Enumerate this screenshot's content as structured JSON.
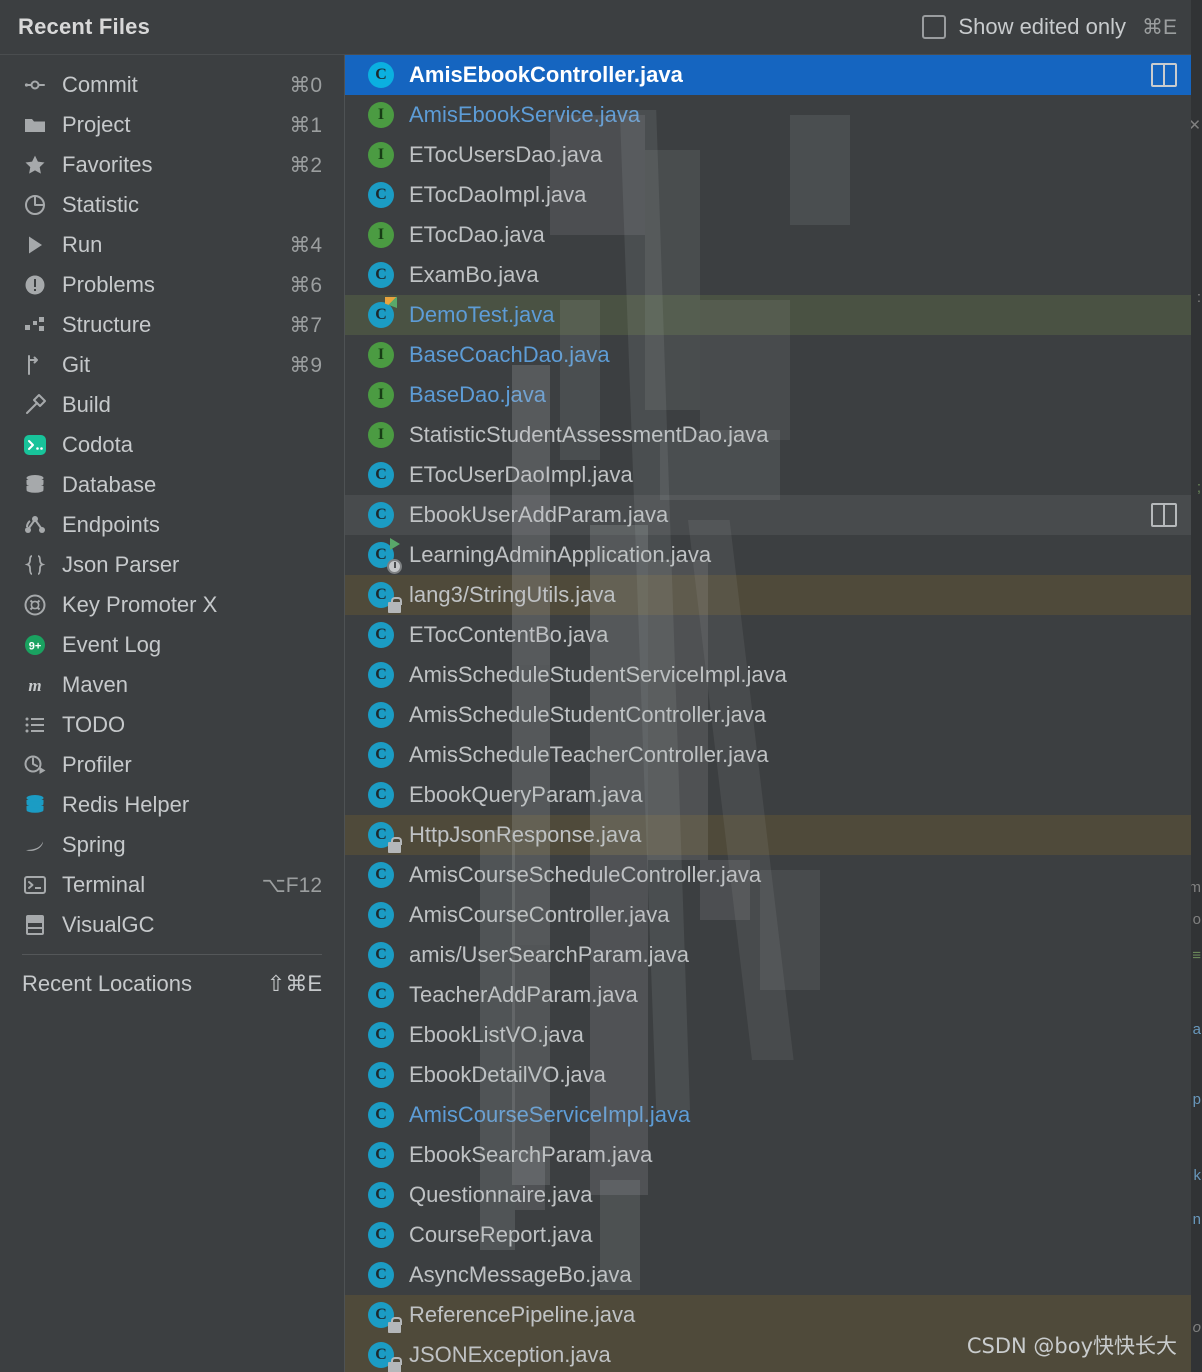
{
  "header": {
    "title": "Recent Files",
    "edited_only_label": "Show edited only",
    "edited_only_shortcut": "⌘E",
    "edited_only_checked": false
  },
  "sidebar": {
    "items": [
      {
        "label": "Commit",
        "shortcut": "⌘0",
        "icon": "commit-icon"
      },
      {
        "label": "Project",
        "shortcut": "⌘1",
        "icon": "folder-icon"
      },
      {
        "label": "Favorites",
        "shortcut": "⌘2",
        "icon": "star-icon"
      },
      {
        "label": "Statistic",
        "shortcut": "",
        "icon": "pie-chart-icon"
      },
      {
        "label": "Run",
        "shortcut": "⌘4",
        "icon": "play-icon"
      },
      {
        "label": "Problems",
        "shortcut": "⌘6",
        "icon": "exclamation-circle-icon"
      },
      {
        "label": "Structure",
        "shortcut": "⌘7",
        "icon": "structure-icon"
      },
      {
        "label": "Git",
        "shortcut": "⌘9",
        "icon": "git-branch-icon"
      },
      {
        "label": "Build",
        "shortcut": "",
        "icon": "hammer-icon"
      },
      {
        "label": "Codota",
        "shortcut": "",
        "icon": "codota-icon"
      },
      {
        "label": "Database",
        "shortcut": "",
        "icon": "database-icon"
      },
      {
        "label": "Endpoints",
        "shortcut": "",
        "icon": "endpoints-icon"
      },
      {
        "label": "Json Parser",
        "shortcut": "",
        "icon": "braces-icon"
      },
      {
        "label": "Key Promoter X",
        "shortcut": "",
        "icon": "key-promoter-icon"
      },
      {
        "label": "Event Log",
        "shortcut": "",
        "icon": "event-log-badge-icon"
      },
      {
        "label": "Maven",
        "shortcut": "",
        "icon": "maven-icon"
      },
      {
        "label": "TODO",
        "shortcut": "",
        "icon": "todo-list-icon"
      },
      {
        "label": "Profiler",
        "shortcut": "",
        "icon": "profiler-icon"
      },
      {
        "label": "Redis Helper",
        "shortcut": "",
        "icon": "redis-database-icon"
      },
      {
        "label": "Spring",
        "shortcut": "",
        "icon": "spring-leaf-icon"
      },
      {
        "label": "Terminal",
        "shortcut": "⌥F12",
        "icon": "terminal-icon"
      },
      {
        "label": "VisualGC",
        "shortcut": "",
        "icon": "visualgc-icon"
      }
    ],
    "recent_locations": {
      "label": "Recent Locations",
      "shortcut": "⇧⌘E"
    },
    "event_log_badge": "9+",
    "maven_glyph": "m"
  },
  "files": [
    {
      "name": "AmisEbookController.java",
      "kind": "class",
      "state": "selected",
      "split": true,
      "link": false,
      "badge": ""
    },
    {
      "name": "AmisEbookService.java",
      "kind": "interface",
      "state": "normal",
      "split": false,
      "link": true,
      "badge": ""
    },
    {
      "name": "ETocUsersDao.java",
      "kind": "interface",
      "state": "normal",
      "split": false,
      "link": false,
      "badge": ""
    },
    {
      "name": "ETocDaoImpl.java",
      "kind": "class",
      "state": "normal",
      "split": false,
      "link": false,
      "badge": ""
    },
    {
      "name": "ETocDao.java",
      "kind": "interface",
      "state": "normal",
      "split": false,
      "link": false,
      "badge": ""
    },
    {
      "name": "ExamBo.java",
      "kind": "class",
      "state": "normal",
      "split": false,
      "link": false,
      "badge": ""
    },
    {
      "name": "DemoTest.java",
      "kind": "class",
      "state": "green",
      "split": false,
      "link": true,
      "badge": "flag"
    },
    {
      "name": "BaseCoachDao.java",
      "kind": "interface",
      "state": "normal",
      "split": false,
      "link": true,
      "badge": ""
    },
    {
      "name": "BaseDao.java",
      "kind": "interface",
      "state": "normal",
      "split": false,
      "link": true,
      "badge": ""
    },
    {
      "name": "StatisticStudentAssessmentDao.java",
      "kind": "interface",
      "state": "normal",
      "split": false,
      "link": false,
      "badge": ""
    },
    {
      "name": "ETocUserDaoImpl.java",
      "kind": "class",
      "state": "normal",
      "split": false,
      "link": false,
      "badge": ""
    },
    {
      "name": "EbookUserAddParam.java",
      "kind": "class",
      "state": "gray",
      "split": true,
      "link": false,
      "badge": ""
    },
    {
      "name": "LearningAdminApplication.java",
      "kind": "class",
      "state": "normal",
      "split": false,
      "link": false,
      "badge": "boot"
    },
    {
      "name": "lang3/StringUtils.java",
      "kind": "class",
      "state": "olive",
      "split": false,
      "link": false,
      "badge": "lock"
    },
    {
      "name": "ETocContentBo.java",
      "kind": "class",
      "state": "normal",
      "split": false,
      "link": false,
      "badge": ""
    },
    {
      "name": "AmisScheduleStudentServiceImpl.java",
      "kind": "class",
      "state": "normal",
      "split": false,
      "link": false,
      "badge": ""
    },
    {
      "name": "AmisScheduleStudentController.java",
      "kind": "class",
      "state": "normal",
      "split": false,
      "link": false,
      "badge": ""
    },
    {
      "name": "AmisScheduleTeacherController.java",
      "kind": "class",
      "state": "normal",
      "split": false,
      "link": false,
      "badge": ""
    },
    {
      "name": "EbookQueryParam.java",
      "kind": "class",
      "state": "normal",
      "split": false,
      "link": false,
      "badge": ""
    },
    {
      "name": "HttpJsonResponse.java",
      "kind": "class",
      "state": "olive",
      "split": false,
      "link": false,
      "badge": "lock"
    },
    {
      "name": "AmisCourseScheduleController.java",
      "kind": "class",
      "state": "normal",
      "split": false,
      "link": false,
      "badge": ""
    },
    {
      "name": "AmisCourseController.java",
      "kind": "class",
      "state": "normal",
      "split": false,
      "link": false,
      "badge": ""
    },
    {
      "name": "amis/UserSearchParam.java",
      "kind": "class",
      "state": "normal",
      "split": false,
      "link": false,
      "badge": ""
    },
    {
      "name": "TeacherAddParam.java",
      "kind": "class",
      "state": "normal",
      "split": false,
      "link": false,
      "badge": ""
    },
    {
      "name": "EbookListVO.java",
      "kind": "class",
      "state": "normal",
      "split": false,
      "link": false,
      "badge": ""
    },
    {
      "name": "EbookDetailVO.java",
      "kind": "class",
      "state": "normal",
      "split": false,
      "link": false,
      "badge": ""
    },
    {
      "name": "AmisCourseServiceImpl.java",
      "kind": "class",
      "state": "normal",
      "split": false,
      "link": true,
      "badge": ""
    },
    {
      "name": "EbookSearchParam.java",
      "kind": "class",
      "state": "normal",
      "split": false,
      "link": false,
      "badge": ""
    },
    {
      "name": "Questionnaire.java",
      "kind": "class",
      "state": "normal",
      "split": false,
      "link": false,
      "badge": ""
    },
    {
      "name": "CourseReport.java",
      "kind": "class",
      "state": "normal",
      "split": false,
      "link": false,
      "badge": ""
    },
    {
      "name": "AsyncMessageBo.java",
      "kind": "class",
      "state": "normal",
      "split": false,
      "link": false,
      "badge": ""
    },
    {
      "name": "ReferencePipeline.java",
      "kind": "class",
      "state": "olive",
      "split": false,
      "link": false,
      "badge": "lock"
    },
    {
      "name": "JSONException.java",
      "kind": "class",
      "state": "olive",
      "split": false,
      "link": false,
      "badge": "lock"
    }
  ],
  "watermark": "CSDN @boy快快长大",
  "colors": {
    "popup_bg": "#3c3f41",
    "selection_blue": "#1565c0",
    "class_icon": "#1b9cc4",
    "interface_icon": "#4b9b42",
    "link_text": "#5d9cd6",
    "row_green": "#4a5243",
    "row_gray": "#484b4d",
    "row_olive": "#4f4a3a"
  }
}
